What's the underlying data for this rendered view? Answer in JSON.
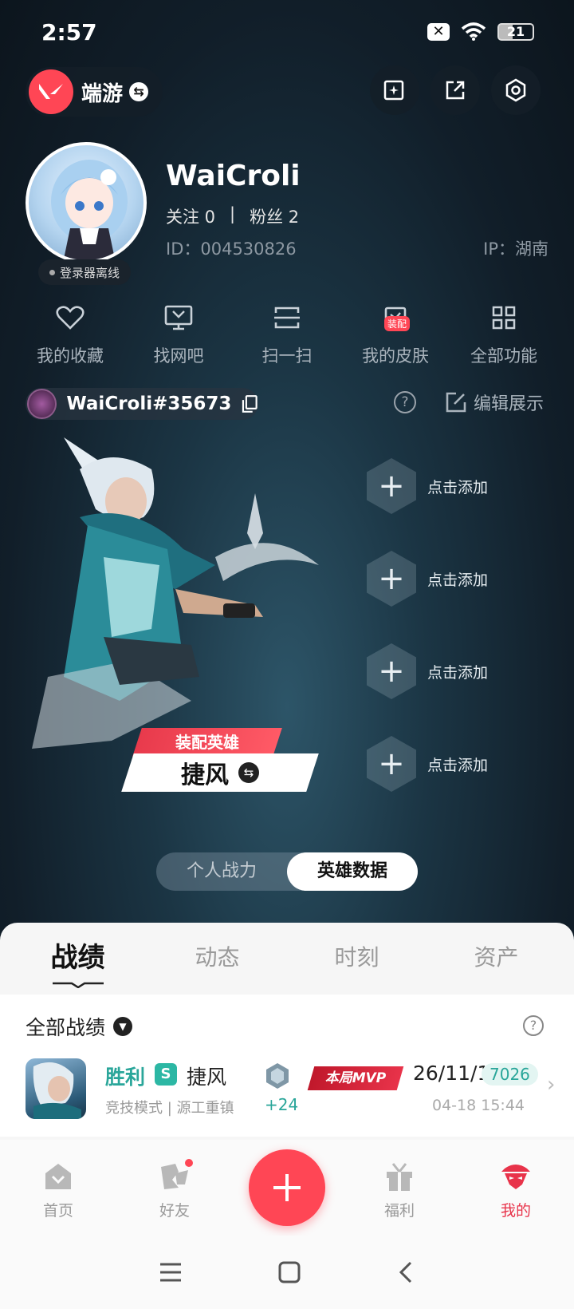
{
  "status_bar": {
    "time": "2:57",
    "battery": "21",
    "x_icon": "✕"
  },
  "header": {
    "game_name": "端游",
    "swap_glyph": "⇆"
  },
  "profile": {
    "username": "WaiCroli",
    "follow_label": "关注 0",
    "divider": "|",
    "fans_label": "粉丝 2",
    "id_text": "ID：004530826",
    "ip_text": "IP：湖南",
    "offline_badge": "登录器离线"
  },
  "quick_actions": [
    {
      "label": "我的收藏",
      "icon": "heart-icon"
    },
    {
      "label": "找网吧",
      "icon": "monitor-icon"
    },
    {
      "label": "扫一扫",
      "icon": "scan-icon"
    },
    {
      "label": "我的皮肤",
      "icon": "skin-icon",
      "badge": "装配"
    },
    {
      "label": "全部功能",
      "icon": "grid-icon"
    }
  ],
  "riot": {
    "name": "WaiCroli#35673",
    "help": "?",
    "edit_label": "编辑展示"
  },
  "hero": {
    "tag_label": "装配英雄",
    "name": "捷风",
    "swap_glyph": "⇆"
  },
  "slots": [
    {
      "label": "点击添加",
      "plus": "+"
    },
    {
      "label": "点击添加",
      "plus": "+"
    },
    {
      "label": "点击添加",
      "plus": "+"
    },
    {
      "label": "点击添加",
      "plus": "+"
    }
  ],
  "segment": {
    "left": "个人战力",
    "right": "英雄数据",
    "active": "right"
  },
  "tabs": [
    "战绩",
    "动态",
    "时刻",
    "资产"
  ],
  "records": {
    "title": "全部战绩",
    "caret": "▼",
    "help": "?",
    "match": {
      "result": "胜利",
      "rank_letter": "S",
      "agent": "捷风",
      "mode": "竞技模式 | 源工重镇",
      "rr_change": "+24",
      "mvp_label": "本局MVP",
      "kda": "26/11/1",
      "score": "7026",
      "time": "04-18 15:44",
      "chevron": "›"
    }
  },
  "bottom_nav": [
    {
      "label": "首页",
      "icon": "home-icon"
    },
    {
      "label": "好友",
      "icon": "friends-icon"
    },
    {
      "label": "福利",
      "icon": "gift-icon"
    },
    {
      "label": "我的",
      "icon": "me-icon",
      "active": true
    }
  ],
  "fab": {
    "plus": "+"
  },
  "colors": {
    "accent": "#ff4655",
    "win": "#2aa69a",
    "mvp": "#c0182b"
  }
}
